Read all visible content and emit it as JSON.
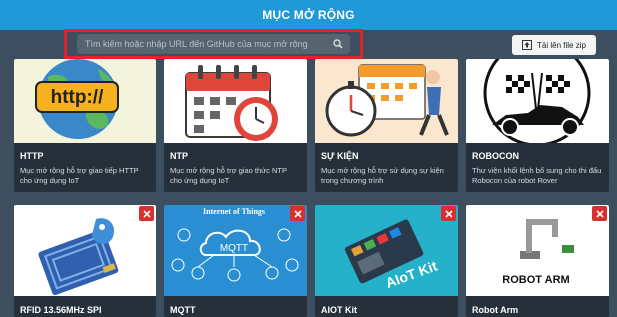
{
  "header": {
    "title": "MỤC MỞ RỘNG"
  },
  "search": {
    "placeholder": "Tìm kiếm hoặc nhập URL đến GitHub của mục mở rộng"
  },
  "toolbar": {
    "upload_label": "Tải lên file zip"
  },
  "colors": {
    "header_bg": "#1f9ad6",
    "page_bg": "#3d4f5e",
    "highlight_border": "#e0242d",
    "delete_button": "#d9302f"
  },
  "extensions_row1": [
    {
      "title": "HTTP",
      "description": "Mục mở rộng hỗ trợ giao tiếp HTTP cho ứng dụng IoT",
      "image_text": "http://",
      "icon": "globe-http-icon"
    },
    {
      "title": "NTP",
      "description": "Mục mở rộng hỗ trợ giao thức NTP cho ứng dụng IoT",
      "icon": "calendar-clock-icon"
    },
    {
      "title": "SỰ KIỆN",
      "description": "Mục mở rộng hỗ trợ sử dụng sự kiện trong chương trình",
      "icon": "stopwatch-calendar-icon"
    },
    {
      "title": "ROBOCON",
      "description": "Thư viện khối lệnh bổ sung cho thi đấu Robocon của robot Rover",
      "icon": "race-car-flags-icon"
    }
  ],
  "extensions_row2": [
    {
      "title": "RFID 13.56MHz SPI",
      "icon": "rfid-module-icon"
    },
    {
      "title": "MQTT",
      "image_heading": "Internet of Things",
      "image_label": "MQTT",
      "icon": "mqtt-cloud-icon"
    },
    {
      "title": "AIOT Kit",
      "image_label": "AIoT Kit",
      "icon": "aiot-kit-icon"
    },
    {
      "title": "Robot Arm",
      "image_label": "ROBOT ARM",
      "icon": "robot-arm-icon"
    }
  ]
}
